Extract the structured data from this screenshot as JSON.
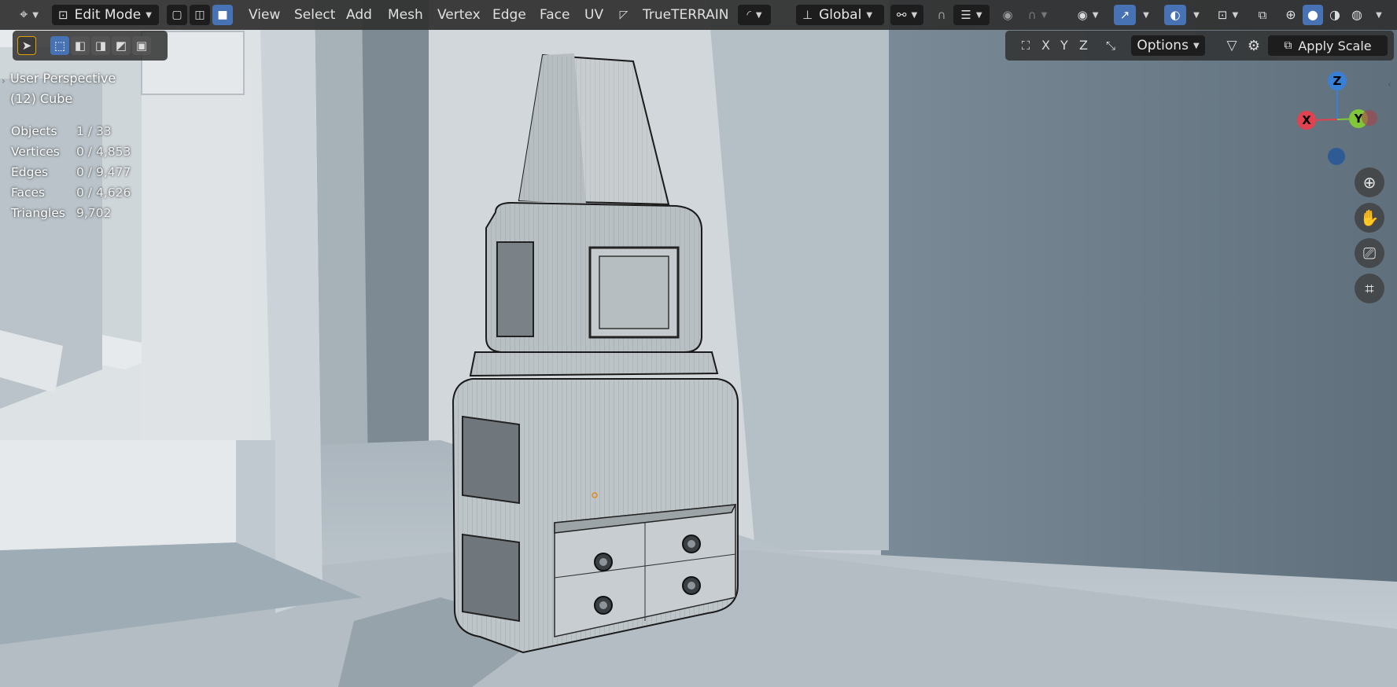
{
  "header": {
    "mode_label": "Edit Mode",
    "menus": [
      "View",
      "Select",
      "Add",
      "Mesh",
      "Vertex",
      "Edge",
      "Face",
      "UV"
    ],
    "addon_label": "TrueTERRAIN",
    "orientation_label": "Global"
  },
  "toolbar2": {
    "axes": [
      "X",
      "Y",
      "Z"
    ],
    "options_label": "Options",
    "apply_scale_label": "Apply Scale"
  },
  "overlay": {
    "view_name": "User Perspective",
    "object_name": "(12) Cube",
    "stats": [
      {
        "label": "Objects",
        "value": "1 / 33"
      },
      {
        "label": "Vertices",
        "value": "0 / 4,853"
      },
      {
        "label": "Edges",
        "value": "0 / 9,477"
      },
      {
        "label": "Faces",
        "value": "0 / 4,626"
      },
      {
        "label": "Triangles",
        "value": "9,702"
      }
    ]
  },
  "gizmo": {
    "x_label": "X",
    "y_label": "Y",
    "z_label": "Z",
    "colors": {
      "x": "#e0424f",
      "y": "#80c83a",
      "z": "#3a7fd6"
    }
  },
  "icons": {
    "nav": [
      "zoom-icon",
      "hand-pan-icon",
      "camera-icon",
      "grid-ortho-icon"
    ]
  },
  "colors": {
    "accent_blue": "#4772b3",
    "header_bg": "#303030",
    "scene_wall": "#d8dcdf",
    "scene_shadow": "#6a7b87"
  }
}
